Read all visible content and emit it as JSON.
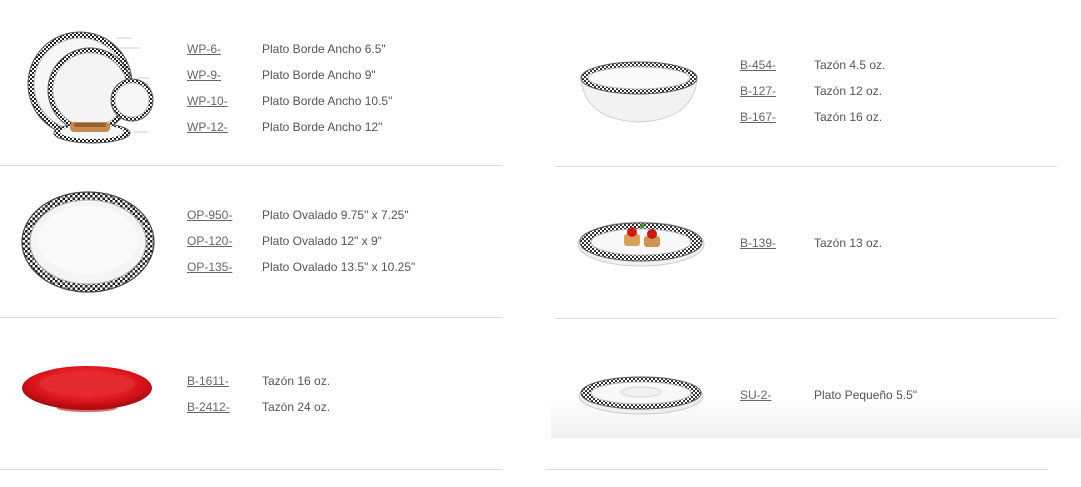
{
  "left": [
    {
      "image_name": "wide-rim-plates-image",
      "items": [
        {
          "code": "WP-6-",
          "desc": "Plato Borde Ancho 6.5\""
        },
        {
          "code": "WP-9-",
          "desc": "Plato Borde Ancho 9\""
        },
        {
          "code": "WP-10-",
          "desc": "Plato Borde Ancho 10.5\""
        },
        {
          "code": "WP-12-",
          "desc": "Plato Borde Ancho 12\""
        }
      ]
    },
    {
      "image_name": "oval-platter-image",
      "items": [
        {
          "code": "OP-950-",
          "desc": "Plato Ovalado 9.75\" x 7.25\""
        },
        {
          "code": "OP-120-",
          "desc": "Plato Ovalado 12\" x 9\""
        },
        {
          "code": "OP-135-",
          "desc": "Plato Ovalado 13.5\" x 10.25\""
        }
      ]
    },
    {
      "image_name": "red-bowl-image",
      "items": [
        {
          "code": "B-1611-",
          "desc": "Tazón 16 oz."
        },
        {
          "code": "B-2412-",
          "desc": "Tazón 24 oz."
        }
      ]
    }
  ],
  "right": [
    {
      "image_name": "checkered-bowl-image",
      "items": [
        {
          "code": "B-454-",
          "desc": "Tazón 4.5 oz."
        },
        {
          "code": "B-127-",
          "desc": "Tazón 12 oz."
        },
        {
          "code": "B-167-",
          "desc": "Tazón 16 oz."
        }
      ]
    },
    {
      "image_name": "pasta-bowl-image",
      "items": [
        {
          "code": "B-139-",
          "desc": "Tazón 13 oz."
        }
      ]
    },
    {
      "image_name": "saucer-image",
      "items": [
        {
          "code": "SU-2-",
          "desc": "Plato Pequeño 5.5\""
        }
      ]
    }
  ],
  "colors": {
    "text": "#555555",
    "link": "#666666",
    "rule": "#dcdcdc",
    "red_bowl": "#d8131a"
  }
}
